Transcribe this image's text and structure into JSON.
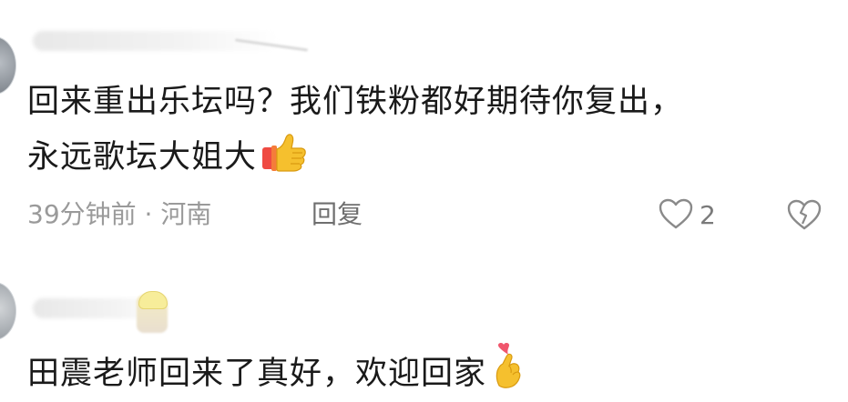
{
  "comments": [
    {
      "lines": [
        "回来重出乐坛吗？我们铁粉都好期待你复出，",
        "永远歌坛大姐大"
      ],
      "emoji_icon": "thumbs-up-icon",
      "meta": "39分钟前 · 河南",
      "reply_label": "回复",
      "like_count": "2"
    },
    {
      "lines": [
        "田震老师回来了真好，欢迎回家"
      ],
      "emoji_icon": "finger-heart-icon"
    }
  ],
  "colors": {
    "text": "#1a1a1a",
    "meta": "#9a9a9a",
    "icon": "#8a8a8a",
    "thumb": "#f5c02e",
    "sleeve": "#ef4a42",
    "heart": "#f0566c"
  }
}
